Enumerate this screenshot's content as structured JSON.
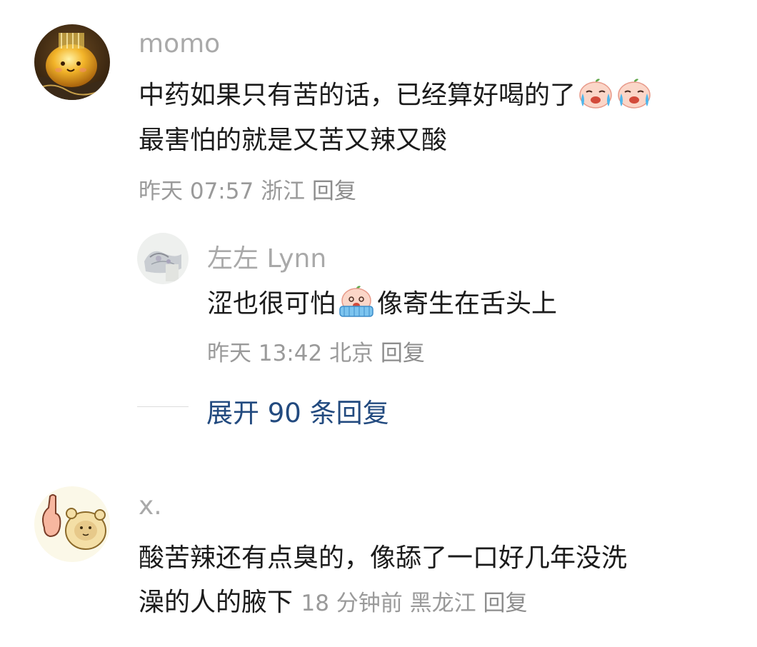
{
  "comments": [
    {
      "username": "momo",
      "line1": "中药如果只有苦的话，已经算好喝的了",
      "line1_emojis": [
        "crying-face-emoji",
        "crying-face-emoji"
      ],
      "line2": "最害怕的就是又苦又辣又酸",
      "meta": {
        "time": "昨天 07:57",
        "location": "浙江",
        "reply": "回复"
      }
    },
    {
      "username": "x.",
      "line1": "酸苦辣还有点臭的，像舔了一口好几年没洗",
      "line2": "澡的人的腋下",
      "meta": {
        "time": "18 分钟前",
        "location": "黑龙江",
        "reply": "回复"
      }
    }
  ],
  "reply": {
    "username": "左左 Lynn",
    "text_before": "涩也很可怕",
    "emoji": "sobbing-face-emoji",
    "text_after": "像寄生在舌头上",
    "meta": {
      "time": "昨天 13:42",
      "location": "北京",
      "reply": "回复"
    }
  },
  "expand": {
    "label": "展开 90 条回复"
  },
  "colors": {
    "username": "#a9a9a9",
    "text": "#1b1b1b",
    "meta": "#9a9a9a",
    "link": "#224a7f",
    "background": "#ffffff"
  }
}
